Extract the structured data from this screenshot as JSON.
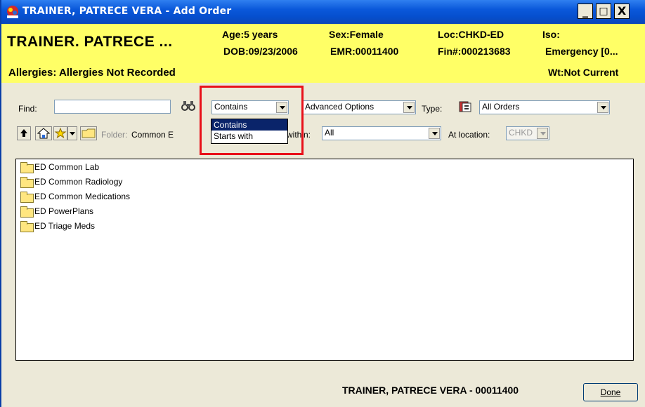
{
  "window": {
    "title": "TRAINER, PATRECE VERA - Add Order",
    "buttons": {
      "minimize": "_",
      "maximize": "□",
      "close": "X"
    }
  },
  "patient_banner": {
    "name": "TRAINER. PATRECE ...",
    "age": "Age:5 years",
    "dob": "DOB:09/23/2006",
    "sex": "Sex:Female",
    "emr": "EMR:00011400",
    "loc": "Loc:CHKD-ED",
    "fin": "Fin#:000213683",
    "iso": "Iso:",
    "encounter": "Emergency [0...",
    "allergies": "Allergies: Allergies Not Recorded",
    "weight": "Wt:Not Current"
  },
  "search": {
    "find_label": "Find:",
    "find_value": "",
    "match_mode": "Contains",
    "match_options": [
      "Contains",
      "Starts with"
    ],
    "advanced_options": "Advanced Options",
    "type_label": "Type:",
    "type_value": "All Orders"
  },
  "folder_bar": {
    "folder_label": "Folder:",
    "folder_value": "Common E",
    "within_label": "within:",
    "within_value": "All",
    "location_label": "At location:",
    "location_value": "CHKD"
  },
  "folders": [
    "ED Common Lab",
    "ED Common Radiology",
    "ED Common Medications",
    "ED PowerPlans",
    "ED Triage Meds"
  ],
  "footer": {
    "patient_id": "TRAINER, PATRECE VERA - 00011400",
    "done_label": "Done"
  },
  "colors": {
    "banner_bg": "#ffff66",
    "title_bg": "#0a58da",
    "highlight_border": "#e8101a",
    "selection_bg": "#0a246a"
  },
  "icons": [
    "app-icon",
    "binoculars-icon",
    "order-type-icon",
    "up-folder-icon",
    "home-icon",
    "favorites-star-icon",
    "folder-icon",
    "dropdown-arrow-icon"
  ]
}
